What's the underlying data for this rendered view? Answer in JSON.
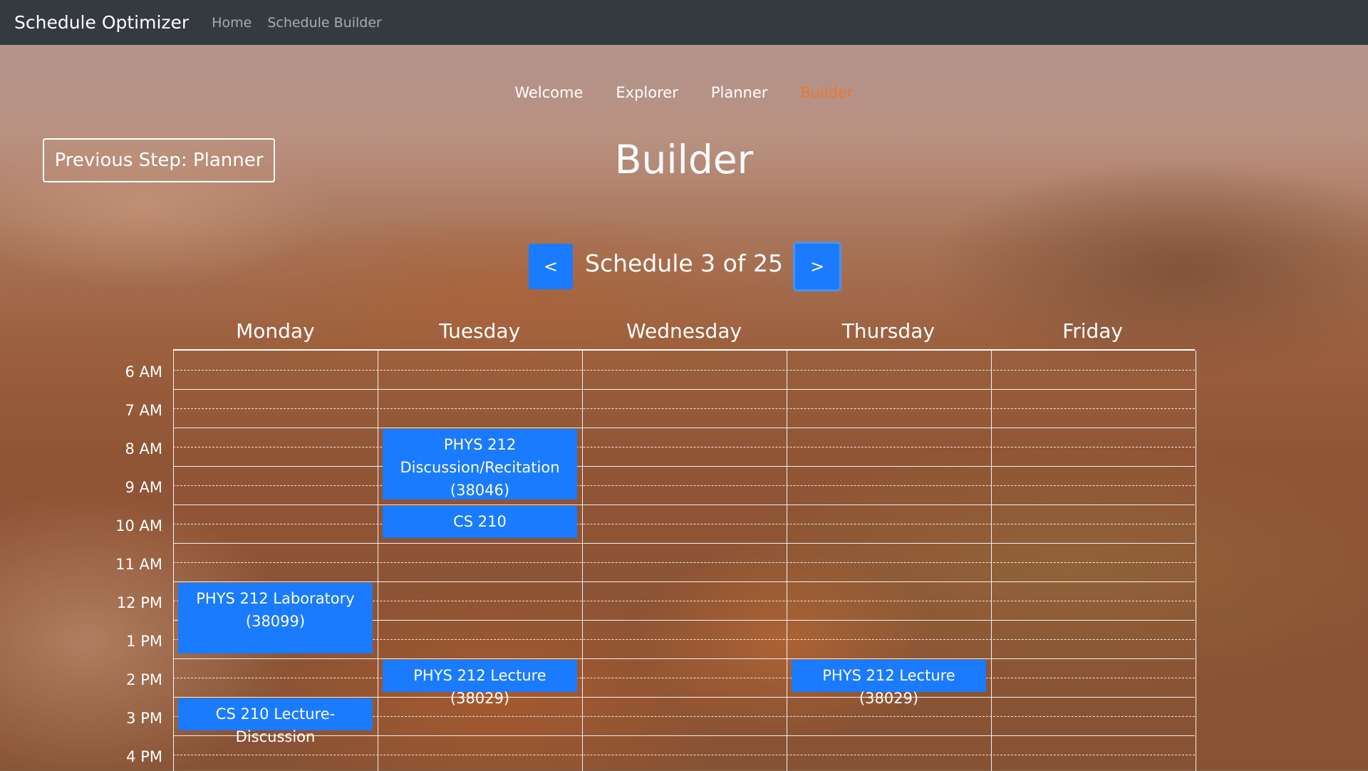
{
  "navbar": {
    "brand": "Schedule Optimizer",
    "links": [
      "Home",
      "Schedule Builder"
    ]
  },
  "steps": [
    {
      "label": "Welcome",
      "active": false
    },
    {
      "label": "Explorer",
      "active": false
    },
    {
      "label": "Planner",
      "active": false
    },
    {
      "label": "Builder",
      "active": true
    }
  ],
  "prev_step_label": "Previous Step: Planner",
  "title": "Builder",
  "pager": {
    "prev_label": "<",
    "next_label": ">",
    "status": "Schedule 3 of 25"
  },
  "days": [
    "Monday",
    "Tuesday",
    "Wednesday",
    "Thursday",
    "Friday"
  ],
  "times": [
    "6 AM",
    "7 AM",
    "8 AM",
    "9 AM",
    "10 AM",
    "11 AM",
    "12 PM",
    "1 PM",
    "2 PM",
    "3 PM",
    "4 PM"
  ],
  "events": [
    {
      "day": "Tuesday",
      "label": "PHYS 212 Discussion/Recitation (38046)"
    },
    {
      "day": "Tuesday",
      "label": "CS 210"
    },
    {
      "day": "Monday",
      "label": "PHYS 212 Laboratory (38099)"
    },
    {
      "day": "Tuesday",
      "label": "PHYS 212 Lecture (38029)"
    },
    {
      "day": "Thursday",
      "label": "PHYS 212 Lecture (38029)"
    },
    {
      "day": "Monday",
      "label": "CS 210 Lecture-Discussion"
    }
  ],
  "colors": {
    "navbar": "#343a40",
    "primary": "#1a7bff",
    "active_step": "#e8782f"
  }
}
